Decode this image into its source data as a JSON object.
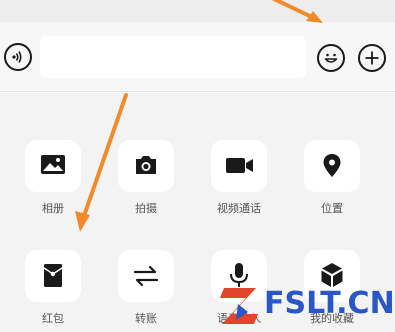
{
  "input_bar": {
    "voice_icon": "voice-wave-icon",
    "text_value": "",
    "emoji_icon": "smiley-icon",
    "plus_icon": "plus-icon"
  },
  "panel": {
    "items": [
      {
        "label": "相册",
        "icon": "image-icon"
      },
      {
        "label": "拍摄",
        "icon": "camera-icon"
      },
      {
        "label": "视频通话",
        "icon": "video-camera-icon"
      },
      {
        "label": "位置",
        "icon": "location-pin-icon"
      },
      {
        "label": "红包",
        "icon": "red-envelope-icon"
      },
      {
        "label": "转账",
        "icon": "transfer-arrows-icon"
      },
      {
        "label": "语音输入",
        "icon": "microphone-icon"
      },
      {
        "label": "我的收藏",
        "icon": "cube-icon"
      }
    ]
  },
  "annotations": {
    "arrow_color": "#f08a2a"
  },
  "watermark": {
    "text": "FSLT.CN",
    "color": "#2b56c6",
    "logo_color": "#e2452b"
  }
}
